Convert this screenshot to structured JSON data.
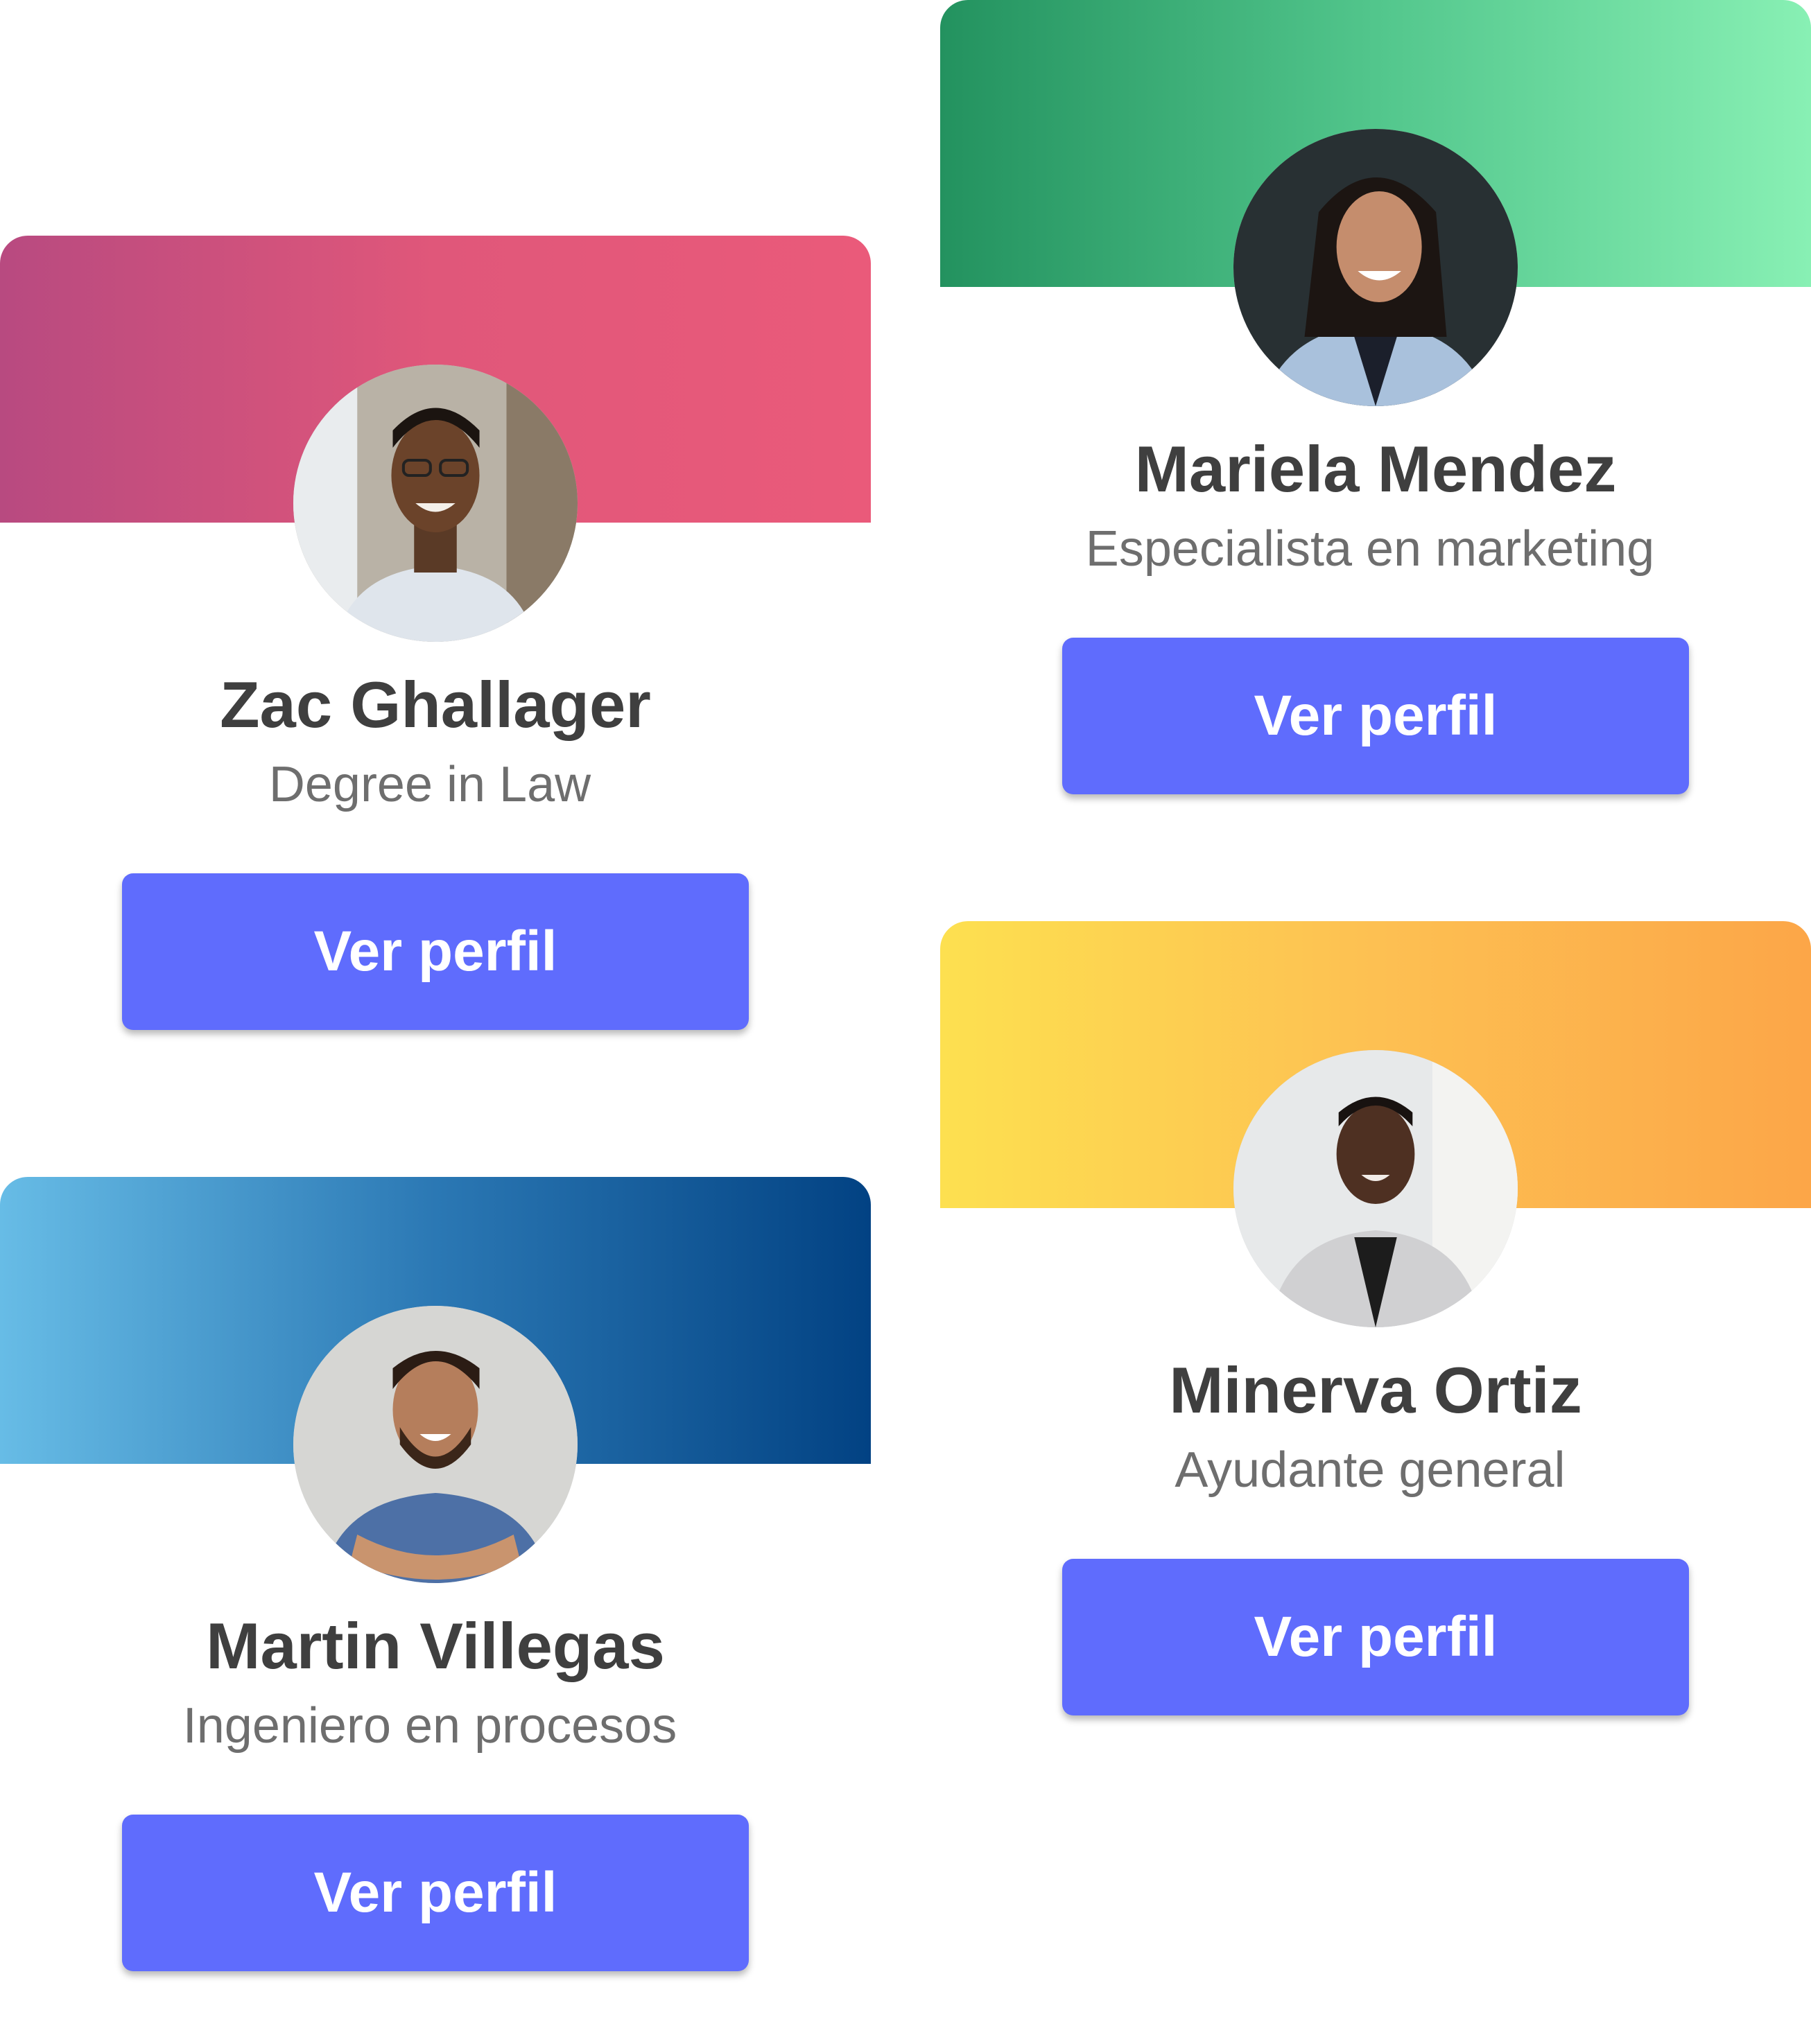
{
  "accent_color": "#5f6cfd",
  "cards": [
    {
      "name": "Zac Ghallager",
      "role": "Degree in Law",
      "button_label": "Ver perfil",
      "banner_colors": [
        "#b84a80",
        "#e0577a",
        "#ea5a7a"
      ],
      "avatar": "photo-man-glasses"
    },
    {
      "name": "Mariela Mendez",
      "role": "Especialista en marketing",
      "button_label": "Ver perfil",
      "banner_colors": [
        "#23925f",
        "#52c68c",
        "#88f0b4"
      ],
      "avatar": "photo-woman-dark-hair"
    },
    {
      "name": "Martin Villegas",
      "role": "Ingeniero en procesos",
      "button_label": "Ver perfil",
      "banner_colors": [
        "#67bce6",
        "#2b78b4",
        "#024283"
      ],
      "avatar": "photo-man-beard"
    },
    {
      "name": "Minerva Ortiz",
      "role": "Ayudante general",
      "button_label": "Ver perfil",
      "banner_colors": [
        "#fde050",
        "#fdc052",
        "#fca648"
      ],
      "avatar": "photo-woman-blazer"
    }
  ]
}
